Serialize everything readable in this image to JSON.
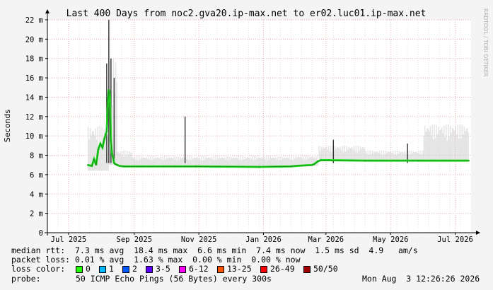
{
  "title": "Last 400 Days from noc2.gva20.ip-max.net to er02.luc01.ip-max.net",
  "watermark": "RRDTOOL / TOBI OETIKER",
  "chart_data": {
    "type": "area",
    "ylabel": "Seconds",
    "ylim": [
      0,
      22
    ],
    "ytick_values": [
      0,
      2,
      4,
      6,
      8,
      10,
      12,
      14,
      16,
      18,
      20,
      22
    ],
    "ytick_labels": [
      "0",
      "2 m",
      "4 m",
      "6 m",
      "8 m",
      "10 m",
      "12 m",
      "14 m",
      "16 m",
      "18 m",
      "20 m",
      "22 m"
    ],
    "xlim_days": [
      0,
      400
    ],
    "x_ticks": [
      {
        "label": "Jul 2025",
        "day": 20
      },
      {
        "label": "Sep 2025",
        "day": 82
      },
      {
        "label": "Nov 2025",
        "day": 143
      },
      {
        "label": "Jan 2026",
        "day": 204
      },
      {
        "label": "Mar 2026",
        "day": 263
      },
      {
        "label": "May 2026",
        "day": 324
      },
      {
        "label": "Jul 2026",
        "day": 385
      }
    ],
    "grid": true,
    "median_series": {
      "name": "median rtt",
      "color": "#22dd22",
      "points": [
        [
          38,
          7.0
        ],
        [
          42,
          6.9
        ],
        [
          44,
          7.6
        ],
        [
          46,
          7.0
        ],
        [
          48,
          8.6
        ],
        [
          50,
          9.2
        ],
        [
          52,
          8.8
        ],
        [
          54,
          9.8
        ],
        [
          56,
          10.5
        ],
        [
          57,
          13.3
        ],
        [
          58,
          14.8
        ],
        [
          59,
          14.2
        ],
        [
          60,
          9.5
        ],
        [
          61,
          8.2
        ],
        [
          62,
          7.8
        ],
        [
          63,
          7.2
        ],
        [
          64,
          7.1
        ],
        [
          66,
          7.0
        ],
        [
          68,
          6.9
        ],
        [
          72,
          6.85
        ],
        [
          120,
          6.85
        ],
        [
          140,
          6.85
        ],
        [
          200,
          6.8
        ],
        [
          230,
          6.85
        ],
        [
          235,
          6.9
        ],
        [
          250,
          7.0
        ],
        [
          252,
          7.1
        ],
        [
          255,
          7.35
        ],
        [
          258,
          7.5
        ],
        [
          300,
          7.45
        ],
        [
          350,
          7.45
        ],
        [
          398,
          7.45
        ]
      ]
    },
    "smoke_bands": [
      {
        "from_day": 38,
        "to_day": 58,
        "low": 6.4,
        "high": 11.0
      },
      {
        "from_day": 58,
        "to_day": 66,
        "low": 7.0,
        "high": 18.0
      },
      {
        "from_day": 66,
        "to_day": 80,
        "low": 6.9,
        "high": 8.5
      },
      {
        "from_day": 80,
        "to_day": 230,
        "low": 6.9,
        "high": 7.9
      },
      {
        "from_day": 230,
        "to_day": 256,
        "low": 6.9,
        "high": 8.0
      },
      {
        "from_day": 256,
        "to_day": 300,
        "low": 7.4,
        "high": 9.0
      },
      {
        "from_day": 300,
        "to_day": 355,
        "low": 7.4,
        "high": 8.5
      },
      {
        "from_day": 355,
        "to_day": 398,
        "low": 7.4,
        "high": 11.2
      }
    ],
    "spikes": [
      {
        "day": 56,
        "high": 17.5
      },
      {
        "day": 58,
        "high": 22.0
      },
      {
        "day": 60,
        "high": 18.0
      },
      {
        "day": 63,
        "high": 16.0
      },
      {
        "day": 130,
        "high": 12.0
      },
      {
        "day": 270,
        "high": 9.6
      },
      {
        "day": 340,
        "high": 9.2
      }
    ]
  },
  "stats": {
    "median_rtt": "median rtt:  7.3 ms avg  18.4 ms max  6.6 ms min  7.4 ms now  1.5 ms sd  4.9   am/s",
    "packet_loss": "packet loss: 0.01 % avg  1.63 % max  0.00 % min  0.00 % now"
  },
  "loss_legend": {
    "label": "loss color:",
    "items": [
      {
        "label": "0",
        "color": "#26ff00"
      },
      {
        "label": "1",
        "color": "#00b8ff"
      },
      {
        "label": "2",
        "color": "#0059ff"
      },
      {
        "label": "3-5",
        "color": "#5e00ff"
      },
      {
        "label": "6-12",
        "color": "#ff00ff"
      },
      {
        "label": "13-25",
        "color": "#ff5500"
      },
      {
        "label": "26-49",
        "color": "#ff0000"
      },
      {
        "label": "50/50",
        "color": "#a10000"
      }
    ]
  },
  "probe": {
    "label": "probe:",
    "text": "50 ICMP Echo Pings (56 Bytes) every 300s",
    "timestamp": "Mon Aug  3 12:26:26 2026"
  },
  "colors": {
    "background": "#f4f4f4",
    "plot_bg": "#ffffff",
    "grid": "#e8b0b0",
    "axis": "#000000"
  }
}
